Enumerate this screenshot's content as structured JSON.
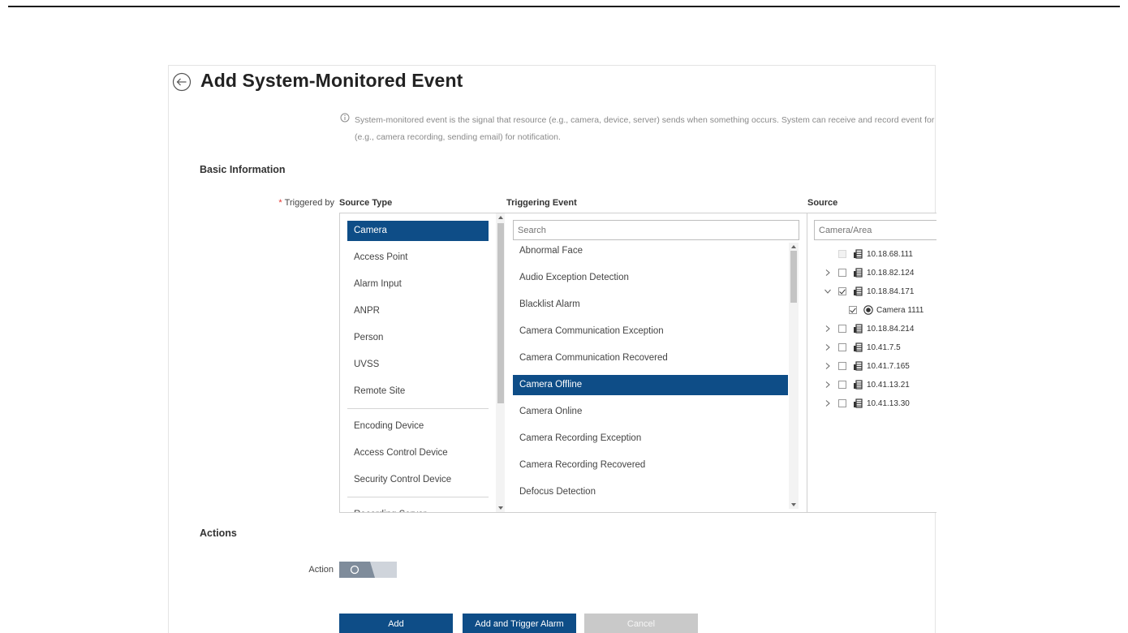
{
  "header": {
    "title": "Add System-Monitored Event"
  },
  "notice": {
    "line1": "System-monitored event is the signal that resource (e.g., camera, device, server) sends when something occurs. System can receive and record event for",
    "line2": "(e.g., camera recording, sending email) for notification."
  },
  "basic_info": {
    "section_title": "Basic Information",
    "triggered_by_label": "Triggered by",
    "required_mark": "*",
    "col_source_type": "Source Type",
    "col_triggering_event": "Triggering Event",
    "col_source": "Source"
  },
  "source_types": [
    {
      "label": "Camera",
      "selected": true
    },
    {
      "label": "Access Point"
    },
    {
      "label": "Alarm Input"
    },
    {
      "label": "ANPR"
    },
    {
      "label": "Person"
    },
    {
      "label": "UVSS"
    },
    {
      "label": "Remote Site"
    },
    {
      "label": "Encoding Device"
    },
    {
      "label": "Access Control Device"
    },
    {
      "label": "Security Control Device"
    },
    {
      "label": "Recording Server"
    }
  ],
  "event_search": {
    "placeholder": "Search"
  },
  "events": [
    {
      "label": "Abnormal Face"
    },
    {
      "label": "Audio Exception Detection"
    },
    {
      "label": "Blacklist Alarm"
    },
    {
      "label": "Camera Communication Exception"
    },
    {
      "label": "Camera Communication Recovered"
    },
    {
      "label": "Camera Offline",
      "selected": true
    },
    {
      "label": "Camera Online"
    },
    {
      "label": "Camera Recording Exception"
    },
    {
      "label": "Camera Recording Recovered"
    },
    {
      "label": "Defocus Detection"
    }
  ],
  "source_search": {
    "placeholder": "Camera/Area"
  },
  "source_tree": [
    {
      "label": "10.18.68.111",
      "expandable": false,
      "checked": false,
      "disabled": true
    },
    {
      "label": "10.18.82.124",
      "expandable": true,
      "checked": false
    },
    {
      "label": "10.18.84.171",
      "expandable": true,
      "expanded": true,
      "checked": true
    },
    {
      "label": "Camera 1111",
      "child": true,
      "checked": true
    },
    {
      "label": "10.18.84.214",
      "expandable": true,
      "checked": false
    },
    {
      "label": "10.41.7.5",
      "expandable": true,
      "checked": false
    },
    {
      "label": "10.41.7.165",
      "expandable": true,
      "checked": false
    },
    {
      "label": "10.41.13.21",
      "expandable": true,
      "checked": false
    },
    {
      "label": "10.41.13.30",
      "expandable": true,
      "checked": false
    }
  ],
  "actions": {
    "section_title": "Actions",
    "action_label": "Action",
    "toggle_on": false
  },
  "buttons": {
    "add": "Add",
    "add_trigger": "Add and Trigger Alarm",
    "cancel": "Cancel"
  },
  "colors": {
    "accent": "#0e4d87",
    "required": "#e5322d"
  }
}
